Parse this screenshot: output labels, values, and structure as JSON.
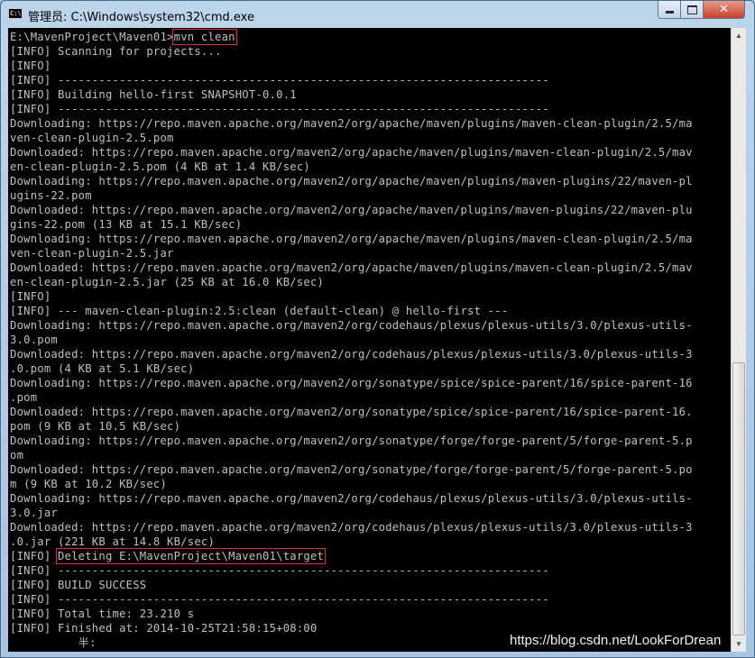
{
  "window": {
    "title": "管理员: C:\\Windows\\system32\\cmd.exe",
    "icon_label": "C:\\",
    "close_label": "✕"
  },
  "console": {
    "lines": [
      "E:\\MavenProject\\Maven01>mvn clean",
      "[INFO] Scanning for projects...",
      "[INFO]",
      "[INFO] ------------------------------------------------------------------------",
      "[INFO] Building hello-first SNAPSHOT-0.0.1",
      "[INFO] ------------------------------------------------------------------------",
      "Downloading: https://repo.maven.apache.org/maven2/org/apache/maven/plugins/maven-clean-plugin/2.5/ma",
      "ven-clean-plugin-2.5.pom",
      "Downloaded: https://repo.maven.apache.org/maven2/org/apache/maven/plugins/maven-clean-plugin/2.5/mav",
      "en-clean-plugin-2.5.pom (4 KB at 1.4 KB/sec)",
      "Downloading: https://repo.maven.apache.org/maven2/org/apache/maven/plugins/maven-plugins/22/maven-pl",
      "ugins-22.pom",
      "Downloaded: https://repo.maven.apache.org/maven2/org/apache/maven/plugins/maven-plugins/22/maven-plu",
      "gins-22.pom (13 KB at 15.1 KB/sec)",
      "Downloading: https://repo.maven.apache.org/maven2/org/apache/maven/plugins/maven-clean-plugin/2.5/ma",
      "ven-clean-plugin-2.5.jar",
      "Downloaded: https://repo.maven.apache.org/maven2/org/apache/maven/plugins/maven-clean-plugin/2.5/mav",
      "en-clean-plugin-2.5.jar (25 KB at 16.0 KB/sec)",
      "[INFO]",
      "[INFO] --- maven-clean-plugin:2.5:clean (default-clean) @ hello-first ---",
      "Downloading: https://repo.maven.apache.org/maven2/org/codehaus/plexus/plexus-utils/3.0/plexus-utils-",
      "3.0.pom",
      "Downloaded: https://repo.maven.apache.org/maven2/org/codehaus/plexus/plexus-utils/3.0/plexus-utils-3",
      ".0.pom (4 KB at 5.1 KB/sec)",
      "Downloading: https://repo.maven.apache.org/maven2/org/sonatype/spice/spice-parent/16/spice-parent-16",
      ".pom",
      "Downloaded: https://repo.maven.apache.org/maven2/org/sonatype/spice/spice-parent/16/spice-parent-16.",
      "pom (9 KB at 10.5 KB/sec)",
      "Downloading: https://repo.maven.apache.org/maven2/org/sonatype/forge/forge-parent/5/forge-parent-5.p",
      "om",
      "Downloaded: https://repo.maven.apache.org/maven2/org/sonatype/forge/forge-parent/5/forge-parent-5.po",
      "m (9 KB at 10.2 KB/sec)",
      "Downloading: https://repo.maven.apache.org/maven2/org/codehaus/plexus/plexus-utils/3.0/plexus-utils-",
      "3.0.jar",
      "Downloaded: https://repo.maven.apache.org/maven2/org/codehaus/plexus/plexus-utils/3.0/plexus-utils-3",
      ".0.jar (221 KB at 14.8 KB/sec)",
      "[INFO] Deleting E:\\MavenProject\\Maven01\\target",
      "[INFO] ------------------------------------------------------------------------",
      "[INFO] BUILD SUCCESS",
      "[INFO] ------------------------------------------------------------------------",
      "[INFO] Total time: 23.210 s",
      "[INFO] Finished at: 2014-10-25T21:58:15+08:00",
      "          半:"
    ],
    "highlights": [
      {
        "line": 0,
        "start": 24,
        "end": 33
      },
      {
        "line": 36,
        "start": 7,
        "end": 46
      }
    ]
  },
  "scrollbar": {
    "up_arrow": "▲",
    "down_arrow": "▼"
  },
  "watermark": "https://blog.csdn.net/LookForDrean",
  "colors": {
    "console_bg": "#000000",
    "console_text": "#c0c0c0",
    "highlight_box": "#e0312e"
  }
}
